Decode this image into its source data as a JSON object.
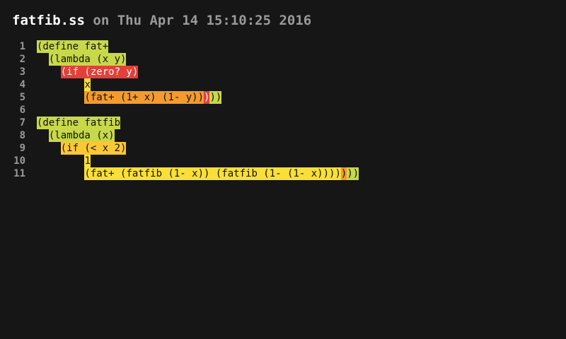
{
  "header": {
    "filename": "fatfib.ss",
    "timestamp": " on Thu Apr 14 15:10:25 2016"
  },
  "colors": {
    "background": "#161616",
    "depth1_lime": "#c8d84a",
    "depth2_red": "#e2403a",
    "depth3_orange": "#f39b2e",
    "depth3_yellow": "#fadf38",
    "depth2_gold": "#fbc835",
    "line_number": "#9a9a9a"
  },
  "code_lines": [
    {
      "n": "1",
      "segments": [
        {
          "t": "(define fat+",
          "c": "lime"
        }
      ]
    },
    {
      "n": "2",
      "segments": [
        {
          "t": "  ",
          "c": "dark"
        },
        {
          "t": "(lambda (x y)",
          "c": "lime"
        }
      ]
    },
    {
      "n": "3",
      "segments": [
        {
          "t": "    ",
          "c": "dark"
        },
        {
          "t": "(if (zero? y)",
          "c": "red"
        }
      ]
    },
    {
      "n": "4",
      "segments": [
        {
          "t": "        ",
          "c": "dark"
        },
        {
          "t": "x",
          "c": "yellow"
        }
      ]
    },
    {
      "n": "5",
      "segments": [
        {
          "t": "        ",
          "c": "dark"
        },
        {
          "t": "(fat+ (1+ x) (1- y))",
          "c": "orange"
        },
        {
          "t": ")",
          "c": "red"
        },
        {
          "t": "))",
          "c": "lime"
        }
      ]
    },
    {
      "n": "6",
      "segments": []
    },
    {
      "n": "7",
      "segments": [
        {
          "t": "(define fatfib",
          "c": "lime"
        }
      ]
    },
    {
      "n": "8",
      "segments": [
        {
          "t": "  ",
          "c": "dark"
        },
        {
          "t": "(lambda (x)",
          "c": "lime"
        }
      ]
    },
    {
      "n": "9",
      "segments": [
        {
          "t": "    ",
          "c": "dark"
        },
        {
          "t": "(if (< x 2)",
          "c": "gold"
        }
      ]
    },
    {
      "n": "10",
      "segments": [
        {
          "t": "        ",
          "c": "dark"
        },
        {
          "t": "1",
          "c": "yellow"
        }
      ]
    },
    {
      "n": "11",
      "segments": [
        {
          "t": "        ",
          "c": "dark"
        },
        {
          "t": "(fat+ (fatfib (1- x)) (fatfib (1- (1- x))))",
          "c": "yellow"
        },
        {
          "t": ")",
          "c": "orange"
        },
        {
          "t": "))",
          "c": "lime"
        }
      ]
    }
  ]
}
